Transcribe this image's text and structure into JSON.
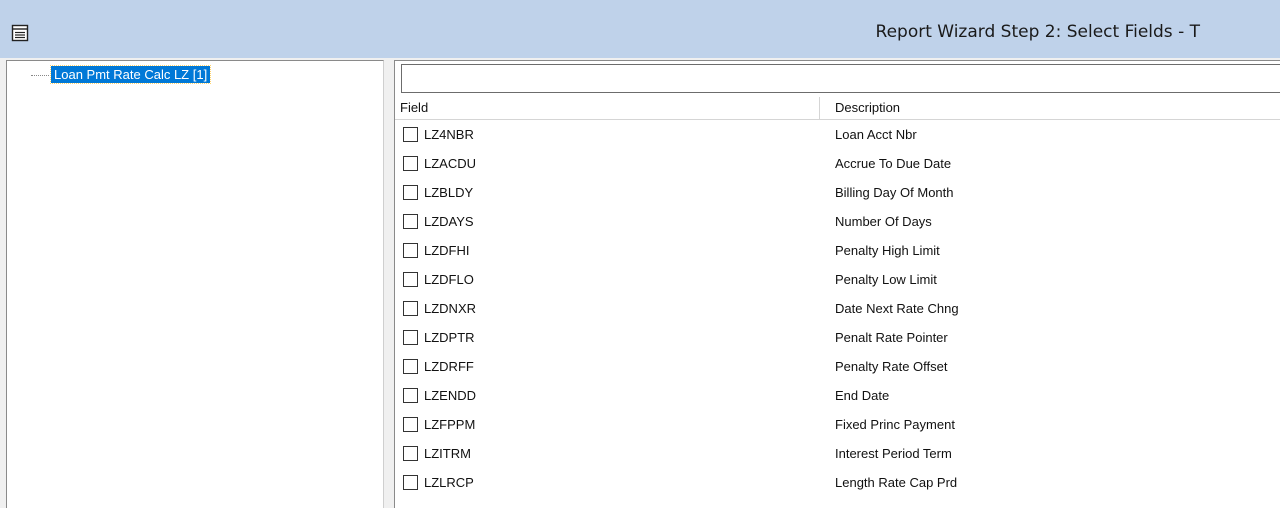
{
  "window": {
    "title": "Report Wizard Step 2:  Select Fields - T",
    "icon": "document-list-icon"
  },
  "tree": {
    "nodes": [
      {
        "label": "Loan Pmt Rate Calc LZ [1]",
        "selected": true
      }
    ]
  },
  "filter": {
    "value": ""
  },
  "table": {
    "columns": [
      "Field",
      "Description"
    ],
    "rows": [
      {
        "field": "LZ4NBR",
        "description": "Loan Acct Nbr",
        "checked": false
      },
      {
        "field": "LZACDU",
        "description": "Accrue To Due Date",
        "checked": false
      },
      {
        "field": "LZBLDY",
        "description": "Billing Day Of Month",
        "checked": false
      },
      {
        "field": "LZDAYS",
        "description": "Number Of Days",
        "checked": false
      },
      {
        "field": "LZDFHI",
        "description": "Penalty High Limit",
        "checked": false
      },
      {
        "field": "LZDFLO",
        "description": "Penalty Low Limit",
        "checked": false
      },
      {
        "field": "LZDNXR",
        "description": "Date Next Rate Chng",
        "checked": false
      },
      {
        "field": "LZDPTR",
        "description": "Penalt Rate Pointer",
        "checked": false
      },
      {
        "field": "LZDRFF",
        "description": "Penalty Rate Offset",
        "checked": false
      },
      {
        "field": "LZENDD",
        "description": "End Date",
        "checked": false
      },
      {
        "field": "LZFPPM",
        "description": "Fixed Princ  Payment",
        "checked": false
      },
      {
        "field": "LZITRM",
        "description": "Interest Period Term",
        "checked": false
      },
      {
        "field": "LZLRCP",
        "description": "Length Rate Cap Prd",
        "checked": false
      }
    ]
  },
  "colors": {
    "titlebar": "#bfd2ea",
    "selection": "#0078d7"
  }
}
